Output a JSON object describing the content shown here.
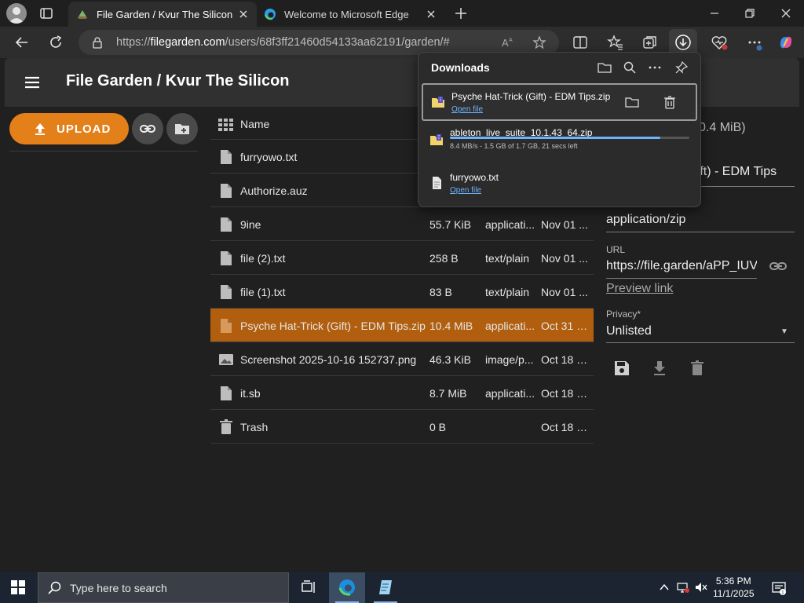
{
  "browser": {
    "tabs": [
      {
        "title": "File Garden / Kvur The Silicon",
        "active": true
      },
      {
        "title": "Welcome to Microsoft Edge",
        "active": false
      }
    ],
    "address": {
      "url_prefix": "https://",
      "url_host": "filegarden.com",
      "url_path": "/users/68f3ff21460d54133aa62191/garden/#"
    }
  },
  "app": {
    "title": "File Garden / Kvur The Silicon",
    "upload_label": "UPLOAD",
    "accent_color": "#e3801a",
    "selected_row_color": "#b15f0f",
    "columns": {
      "name": "Name"
    },
    "files": [
      {
        "name": "furryowo.txt",
        "size": "",
        "type": "",
        "date": "",
        "icon": "file-icon"
      },
      {
        "name": "Authorize.auz",
        "size": "",
        "type": "",
        "date": "",
        "icon": "file-icon"
      },
      {
        "name": "9ine",
        "size": "55.7 KiB",
        "type": "applicati...",
        "date": "Nov 01 ...",
        "icon": "file-icon"
      },
      {
        "name": "file (2).txt",
        "size": "258 B",
        "type": "text/plain",
        "date": "Nov 01 ...",
        "icon": "file-icon"
      },
      {
        "name": "file (1).txt",
        "size": "83 B",
        "type": "text/plain",
        "date": "Nov 01 ...",
        "icon": "file-icon"
      },
      {
        "name": "Psyche Hat-Trick (Gift) - EDM Tips.zip",
        "size": "10.4 MiB",
        "type": "applicati...",
        "date": "Oct 31 2...",
        "icon": "file-icon",
        "selected": true
      },
      {
        "name": "Screenshot 2025-10-16 152737.png",
        "size": "46.3 KiB",
        "type": "image/p...",
        "date": "Oct 18 2...",
        "icon": "image-icon"
      },
      {
        "name": "it.sb",
        "size": "8.7 MiB",
        "type": "applicati...",
        "date": "Oct 18 2...",
        "icon": "file-icon"
      },
      {
        "name": "Trash",
        "size": "0 B",
        "type": "",
        "date": "Oct 18 2...",
        "icon": "trash-icon"
      }
    ],
    "details": {
      "size_partial": "0.4 MiB)",
      "name_partial": "(Gift) - EDM Tips",
      "mime": "application/zip",
      "url_label": "URL",
      "url_value": "https://file.garden/aPP_IUV",
      "preview_link": "Preview link",
      "privacy_label": "Privacy*",
      "privacy_value": "Unlisted"
    }
  },
  "downloads": {
    "title": "Downloads",
    "items": [
      {
        "name": "Psyche Hat-Trick (Gift) - EDM Tips.zip",
        "action": "Open file"
      },
      {
        "name": "ableton_live_suite_10.1.43_64.zip",
        "status": "8.4 MB/s - 1.5 GB of 1.7 GB, 21 secs left",
        "progress": 0.88
      },
      {
        "name": "furryowo.txt",
        "action": "Open file"
      }
    ]
  },
  "taskbar": {
    "search_placeholder": "Type here to search",
    "time": "5:36 PM",
    "date": "11/1/2025"
  }
}
